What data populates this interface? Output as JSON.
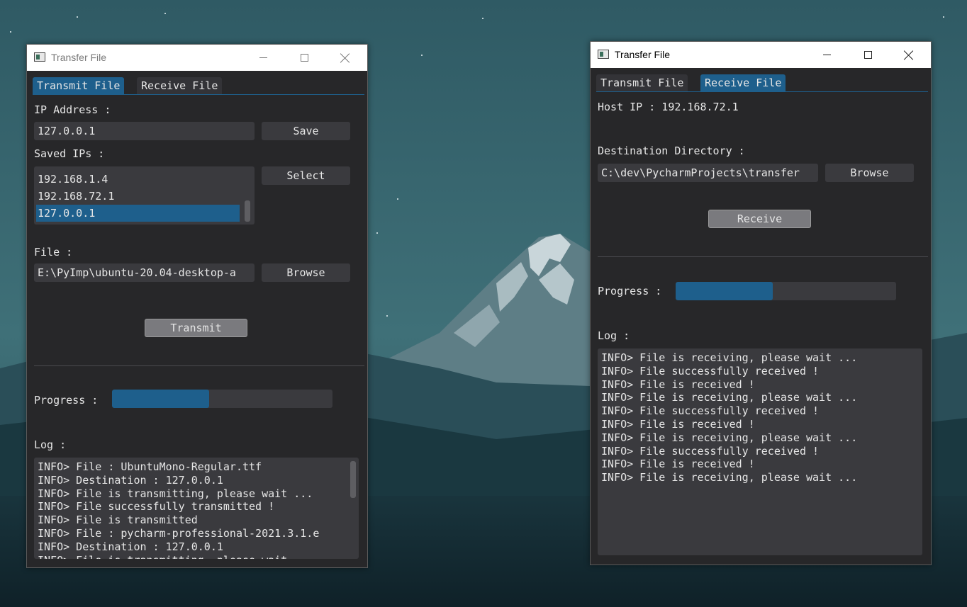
{
  "left_window": {
    "title": "Transfer File",
    "tabs": [
      {
        "label": "Transmit File",
        "active": true
      },
      {
        "label": "Receive File",
        "active": false
      }
    ],
    "ip_label": "IP Address :",
    "ip_value": "127.0.0.1",
    "save_label": "Save",
    "saved_label": "Saved IPs :",
    "saved_ips": [
      "192.168.1.4",
      "192.168.72.1",
      "127.0.0.1"
    ],
    "selected_ip": "127.0.0.1",
    "select_label": "Select",
    "file_label": "File :",
    "file_value": "E:\\PyImp\\ubuntu-20.04-desktop-a",
    "browse_label": "Browse",
    "transmit_label": "Transmit",
    "progress_label": "Progress :",
    "progress_fraction": 0.44,
    "log_label": "Log :",
    "log": [
      "INFO> File : UbuntuMono-Regular.ttf",
      "INFO> Destination : 127.0.0.1",
      "INFO> File is transmitting, please wait ...",
      "INFO> File successfully transmitted !",
      "INFO> File is transmitted",
      "INFO> File : pycharm-professional-2021.3.1.e",
      "INFO> Destination : 127.0.0.1",
      "INFO> File is transmitting, please wait ..."
    ]
  },
  "right_window": {
    "title": "Transfer File",
    "tabs": [
      {
        "label": "Transmit File",
        "active": false
      },
      {
        "label": "Receive File",
        "active": true
      }
    ],
    "host_ip_text": "Host IP : 192.168.72.1",
    "dest_label": "Destination Directory :",
    "dest_value": "C:\\dev\\PycharmProjects\\transfer",
    "browse_label": "Browse",
    "receive_label": "Receive",
    "progress_label": "Progress :",
    "progress_fraction": 0.44,
    "log_label": "Log :",
    "log": [
      "INFO> File is receiving, please wait ...",
      "INFO> File successfully received !",
      "INFO> File is received !",
      "INFO> File is receiving, please wait ...",
      "INFO> File successfully received !",
      "INFO> File is received !",
      "INFO> File is receiving, please wait ...",
      "INFO> File successfully received !",
      "INFO> File is received !",
      "INFO> File is receiving, please wait ..."
    ]
  },
  "colors": {
    "accent": "#1e5f8c",
    "window_bg": "#272729",
    "field_bg": "#3a3a3e",
    "text": "#e6e6e6"
  },
  "icons": [
    "app-icon",
    "minimize-icon",
    "maximize-icon",
    "close-icon"
  ]
}
